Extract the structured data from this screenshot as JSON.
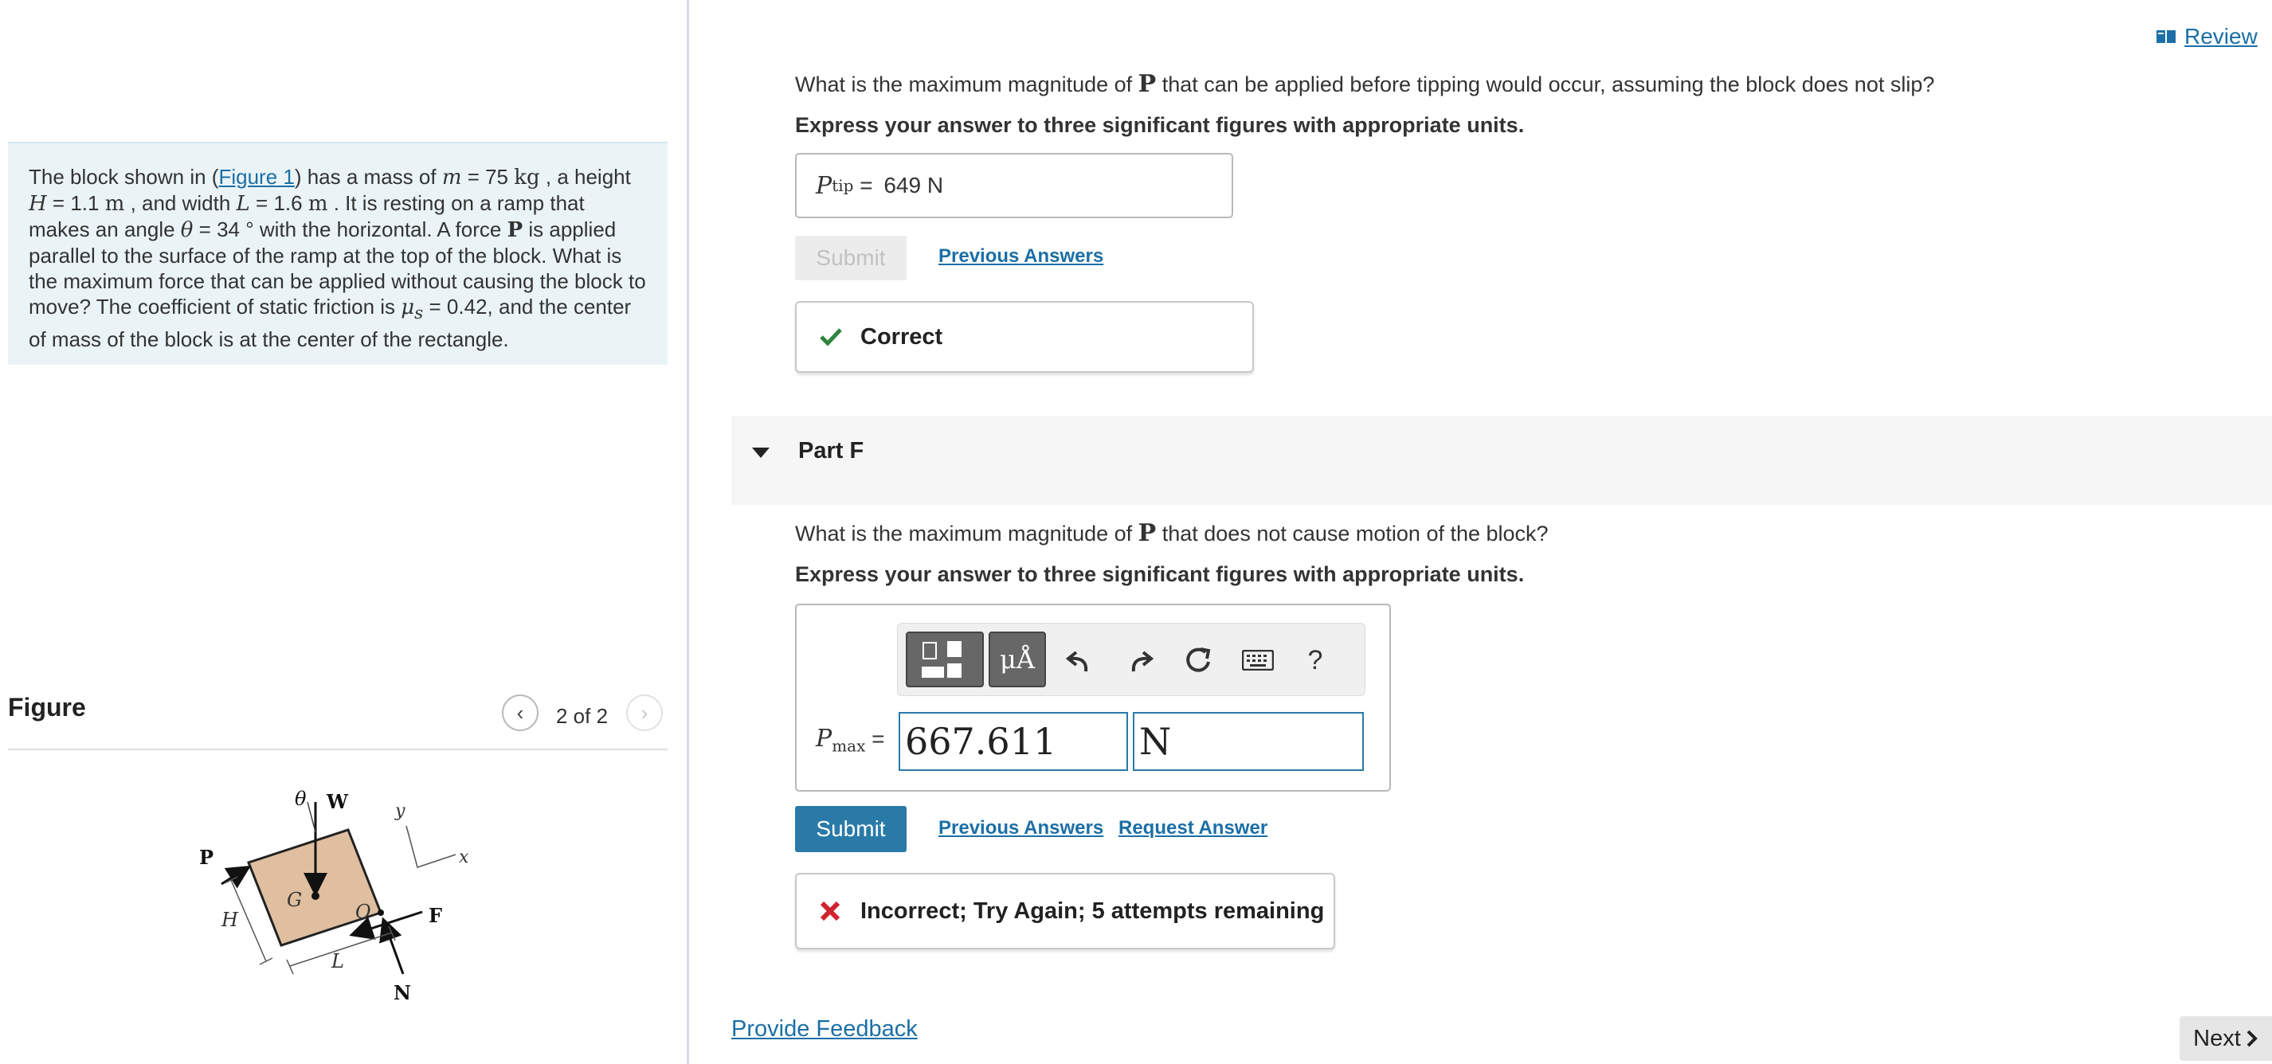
{
  "problem": {
    "t1": "The block shown in (",
    "figure_link": "Figure 1",
    "t2": ") has a mass of ",
    "m_sym": "m",
    "m_val": " = 75 ",
    "m_unit": "kg",
    "t3": " , a height",
    "H_sym": "H",
    "H_val": " = 1.1 ",
    "H_unit": "m",
    "t4": " , and width ",
    "L_sym": "L",
    "L_val": " = 1.6 ",
    "L_unit": "m",
    "t5": " . It is resting on a ramp that makes an angle ",
    "theta_sym": "θ",
    "theta_val": " = 34 ° with the horizontal. A force ",
    "P_sym": "P",
    "t6": " is applied parallel to the surface of the ramp at the top of the block. What is the maximum force that can be applied without causing the block to move? The coefficient of static friction is ",
    "mu_sym": "μ",
    "mu_sub": "s",
    "mu_val": " = 0.42, and the center of mass of the block is at the center of the rectangle."
  },
  "figure": {
    "title": "Figure",
    "counter": "2 of 2",
    "prev_glyph": "‹",
    "next_glyph": "›",
    "labels": {
      "theta": "θ",
      "W": "W",
      "y": "y",
      "x": "x",
      "P": "P",
      "G": "G",
      "O": "O",
      "F": "F",
      "H": "H",
      "L": "L",
      "N": "N"
    },
    "block_color": "#dfbf9f"
  },
  "review": {
    "label": "Review"
  },
  "part_e": {
    "question_a": "What is the maximum magnitude of ",
    "question_P": "P",
    "question_b": " that can be applied before tipping would occur, assuming the block does not slip?",
    "instruction": "Express your answer to three significant figures with appropriate units.",
    "answer_symbol": "P",
    "answer_sub": "tip",
    "answer_eq": " = ",
    "answer_value": "649 N",
    "submit_label": "Submit",
    "previous_answers": "Previous Answers",
    "feedback": "Correct"
  },
  "part_f": {
    "title": "Part F",
    "question_a": "What is the maximum magnitude of ",
    "question_P": "P",
    "question_b": " that does not cause motion of the block?",
    "instruction": "Express your answer to three significant figures with appropriate units.",
    "answer_symbol": "P",
    "answer_sub": "max",
    "answer_eq": " = ",
    "value": "667.611",
    "unit": "N",
    "toolbar": {
      "symbols": "μÅ",
      "help": "?"
    },
    "submit_label": "Submit",
    "previous_answers": "Previous Answers",
    "request_answer": "Request Answer",
    "feedback": "Incorrect; Try Again; 5 attempts remaining"
  },
  "footer": {
    "provide_feedback": "Provide Feedback",
    "next": "Next"
  },
  "colors": {
    "accent": "#2a7aa8",
    "link": "#1b6fa6",
    "correct": "#2e8540",
    "incorrect": "#d0232e"
  }
}
